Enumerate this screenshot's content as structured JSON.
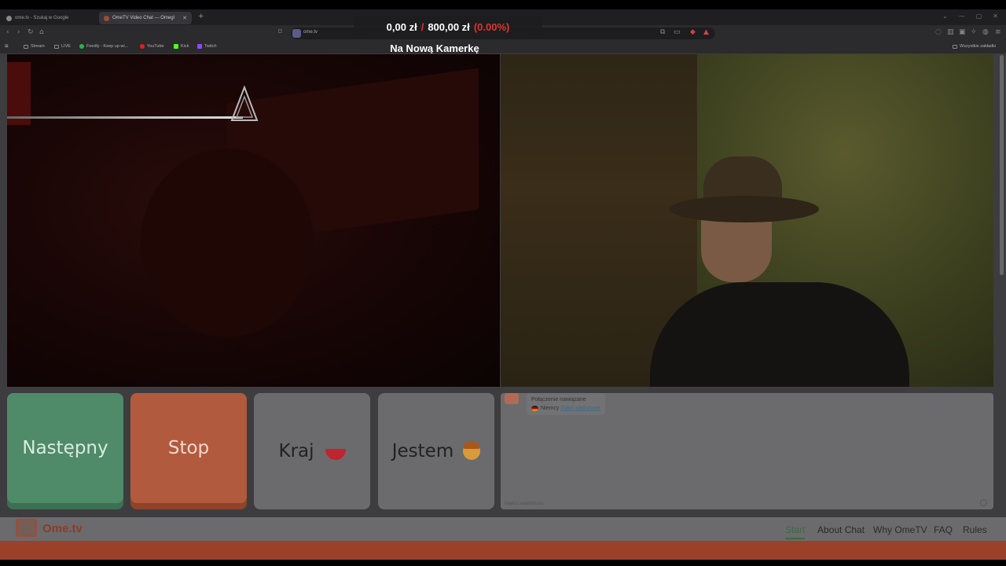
{
  "browser": {
    "tabs": [
      {
        "title": "ome.tv - Szukaj w Google",
        "active": false
      },
      {
        "title": "OmeTV Video Chat — Omegl",
        "active": true
      }
    ],
    "url": "ome.tv",
    "bookmarks": [
      "Stream",
      "LIVE",
      "Feedly - Keep up wi...",
      "YouTube",
      "Kick",
      "Twitch"
    ],
    "bookmarks_right": "Wszystkie zakładki"
  },
  "overlay": {
    "amount": "0,00 zł",
    "separator": "/",
    "goal": "800,00 zł",
    "percent": "(0.00%)",
    "title": "Na Nową Kamerkę"
  },
  "controls": {
    "next": "Następny",
    "stop": "Stop",
    "country": "Kraj",
    "gender": "Jestem"
  },
  "chat": {
    "status": "Połączenie nawiązane",
    "country": "Niemcy",
    "report": "Zgłoś naduzycie",
    "input_placeholder": "Napisz wiadomość"
  },
  "footer": {
    "brand": "Ome.tv",
    "nav": [
      "Start",
      "About Chat",
      "Why OmeTV",
      "FAQ",
      "Rules"
    ]
  },
  "colors": {
    "next_bg": "#4f8a69",
    "stop_bg": "#b25a3d",
    "brand": "#8c3b2a",
    "overlay_red": "#e0362d"
  }
}
